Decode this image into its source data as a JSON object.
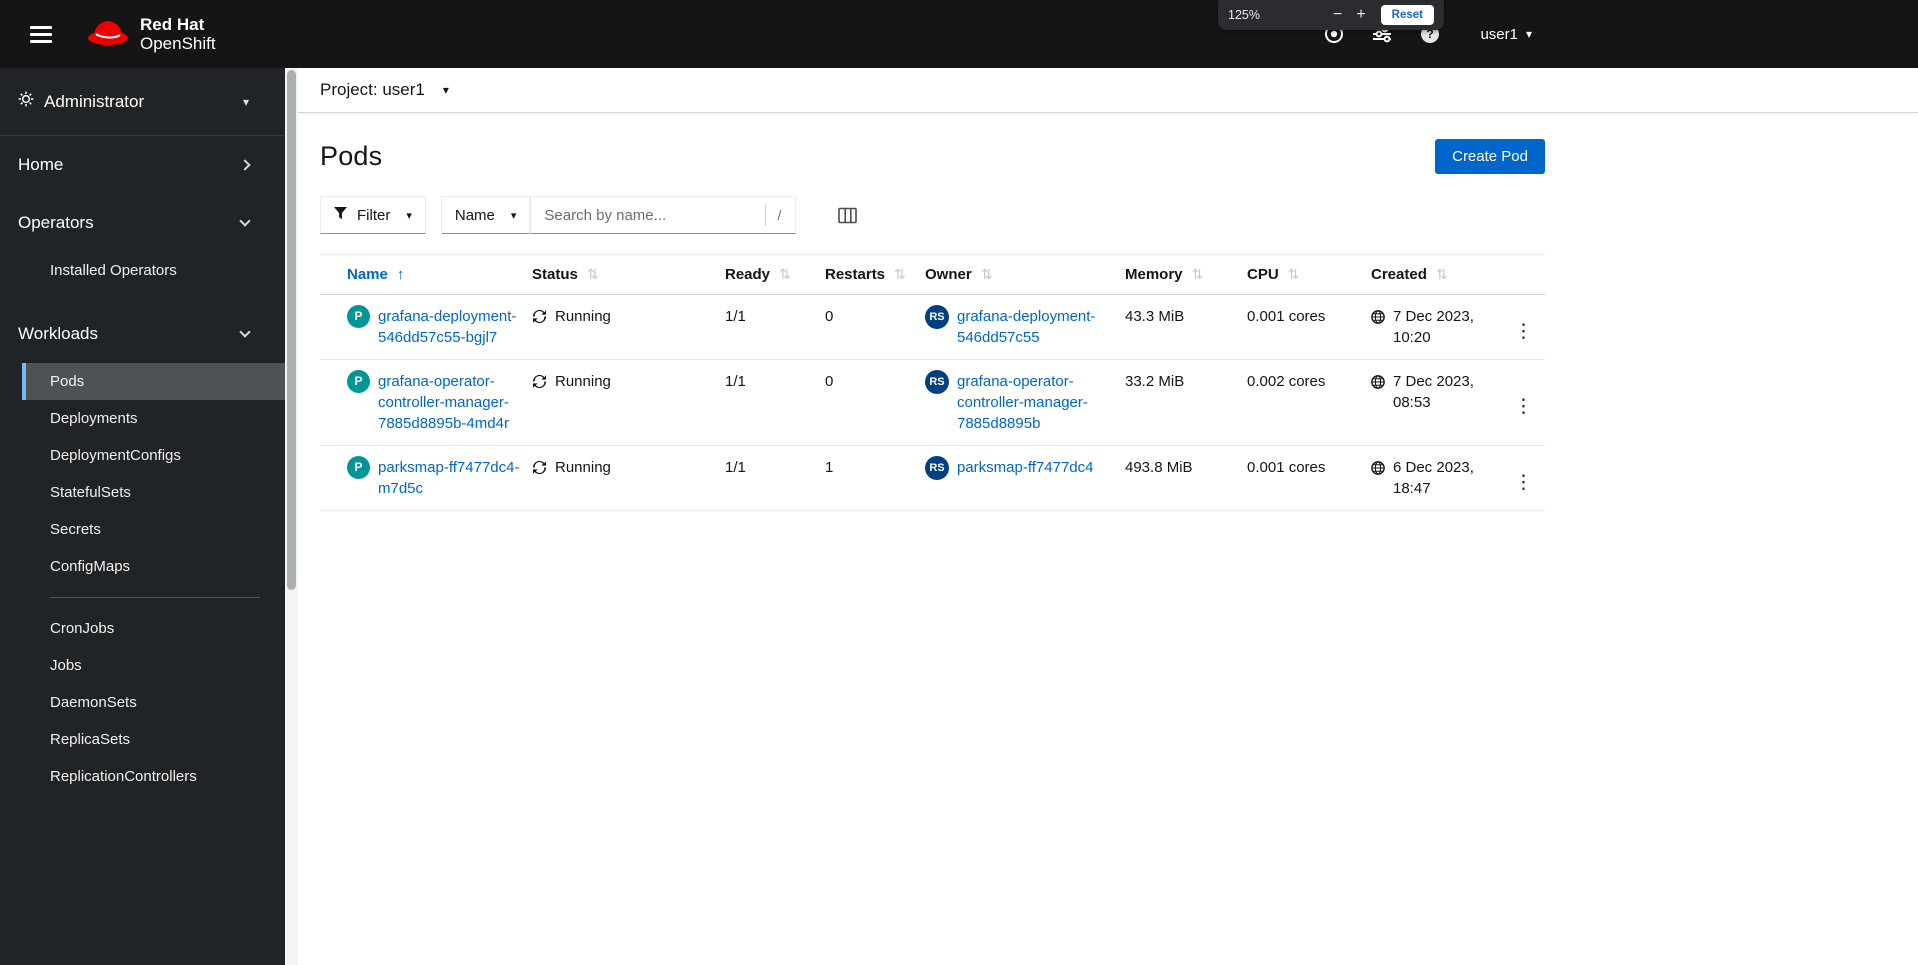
{
  "colors": {
    "accent": "#0066cc",
    "masthead_bg": "#151515",
    "sidebar_bg": "#212427",
    "active_nav_border": "#73bcf7",
    "active_nav_bg": "#4f5255",
    "pod_badge": "#009596",
    "replicaset_badge": "#004080",
    "brand_red": "#ee0000",
    "link": "#0066cc"
  },
  "icons": {
    "kebab": "⋮",
    "sort_inactive": "⇅",
    "sort_ascending": "↑",
    "caret_down": "▾"
  },
  "masthead": {
    "brand_line1": "Red Hat",
    "brand_line2": "OpenShift",
    "username": "user1",
    "zoom_overlay": {
      "level": "125%",
      "minus": "−",
      "plus": "+",
      "reset_label": "Reset"
    }
  },
  "sidebar": {
    "perspective_label": "Administrator",
    "sections": {
      "home": "Home",
      "operators": "Operators",
      "workloads": "Workloads"
    },
    "operators_items": [
      "Installed Operators"
    ],
    "workloads_items_group1": [
      "Pods",
      "Deployments",
      "DeploymentConfigs",
      "StatefulSets",
      "Secrets",
      "ConfigMaps"
    ],
    "workloads_items_group2": [
      "CronJobs",
      "Jobs",
      "DaemonSets",
      "ReplicaSets",
      "ReplicationControllers"
    ],
    "active_item": "Pods"
  },
  "project_bar": {
    "label": "Project: user1"
  },
  "page": {
    "title": "Pods",
    "create_button_label": "Create Pod"
  },
  "toolbar": {
    "filter_label": "Filter",
    "attribute_label": "Name",
    "search_placeholder": "Search by name...",
    "search_shortcut": "/"
  },
  "table": {
    "columns": [
      "Name",
      "Status",
      "Ready",
      "Restarts",
      "Owner",
      "Memory",
      "CPU",
      "Created"
    ],
    "sorted_by": "Name",
    "rows": [
      {
        "badge": "P",
        "name": "grafana-deployment-546dd57c55-bgjl7",
        "status": "Running",
        "ready": "1/1",
        "restarts": "0",
        "owner_badge": "RS",
        "owner": "grafana-deployment-546dd57c55",
        "memory": "43.3 MiB",
        "cpu": "0.001 cores",
        "created": "7 Dec 2023, 10:20"
      },
      {
        "badge": "P",
        "name": "grafana-operator-controller-manager-7885d8895b-4md4r",
        "status": "Running",
        "ready": "1/1",
        "restarts": "0",
        "owner_badge": "RS",
        "owner": "grafana-operator-controller-manager-7885d8895b",
        "memory": "33.2 MiB",
        "cpu": "0.002 cores",
        "created": "7 Dec 2023, 08:53"
      },
      {
        "badge": "P",
        "name": "parksmap-ff7477dc4-m7d5c",
        "status": "Running",
        "ready": "1/1",
        "restarts": "1",
        "owner_badge": "RS",
        "owner": "parksmap-ff7477dc4",
        "memory": "493.8 MiB",
        "cpu": "0.001 cores",
        "created": "6 Dec 2023, 18:47"
      }
    ]
  }
}
